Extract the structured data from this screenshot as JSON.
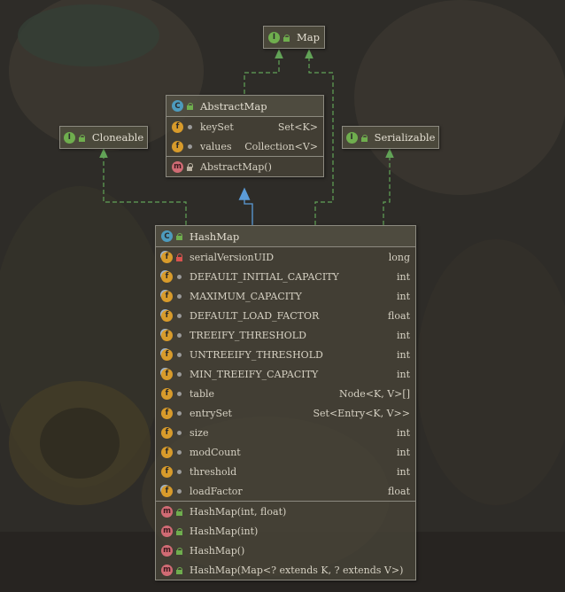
{
  "nodes": {
    "map": {
      "kind": "I",
      "name": "Map"
    },
    "cloneable": {
      "kind": "I",
      "name": "Cloneable"
    },
    "serializable": {
      "kind": "I",
      "name": "Serializable"
    },
    "abstract_map": {
      "kind": "C",
      "name": "AbstractMap",
      "fields": [
        {
          "badge": "f",
          "visibility": "package",
          "name": "keySet",
          "type": "Set<K>"
        },
        {
          "badge": "f",
          "visibility": "package",
          "name": "values",
          "type": "Collection<V>"
        }
      ],
      "methods": [
        {
          "badge": "m",
          "visibility": "protected",
          "name": "AbstractMap()"
        }
      ]
    },
    "hash_map": {
      "kind": "C",
      "name": "HashMap",
      "fields": [
        {
          "badge": "fs",
          "visibility": "private",
          "name": "serialVersionUID",
          "type": "long"
        },
        {
          "badge": "fs",
          "visibility": "package",
          "name": "DEFAULT_INITIAL_CAPACITY",
          "type": "int"
        },
        {
          "badge": "fs",
          "visibility": "package",
          "name": "MAXIMUM_CAPACITY",
          "type": "int"
        },
        {
          "badge": "fs",
          "visibility": "package",
          "name": "DEFAULT_LOAD_FACTOR",
          "type": "float"
        },
        {
          "badge": "fs",
          "visibility": "package",
          "name": "TREEIFY_THRESHOLD",
          "type": "int"
        },
        {
          "badge": "fs",
          "visibility": "package",
          "name": "UNTREEIFY_THRESHOLD",
          "type": "int"
        },
        {
          "badge": "fs",
          "visibility": "package",
          "name": "MIN_TREEIFY_CAPACITY",
          "type": "int"
        },
        {
          "badge": "f",
          "visibility": "package",
          "name": "table",
          "type": "Node<K, V>[]"
        },
        {
          "badge": "f",
          "visibility": "package",
          "name": "entrySet",
          "type": "Set<Entry<K, V>>"
        },
        {
          "badge": "f",
          "visibility": "package",
          "name": "size",
          "type": "int"
        },
        {
          "badge": "f",
          "visibility": "package",
          "name": "modCount",
          "type": "int"
        },
        {
          "badge": "f",
          "visibility": "package",
          "name": "threshold",
          "type": "int"
        },
        {
          "badge": "fs",
          "visibility": "package",
          "name": "loadFactor",
          "type": "float"
        }
      ],
      "methods": [
        {
          "badge": "m",
          "visibility": "public",
          "name": "HashMap(int, float)"
        },
        {
          "badge": "m",
          "visibility": "public",
          "name": "HashMap(int)"
        },
        {
          "badge": "m",
          "visibility": "public",
          "name": "HashMap()"
        },
        {
          "badge": "m",
          "visibility": "public",
          "name": "HashMap(Map<? extends K, ? extends V>)"
        }
      ]
    }
  },
  "edges": [
    {
      "from": "abstract_map",
      "to": "map",
      "relation": "implements"
    },
    {
      "from": "hash_map",
      "to": "abstract_map",
      "relation": "extends"
    },
    {
      "from": "hash_map",
      "to": "map",
      "relation": "implements"
    },
    {
      "from": "hash_map",
      "to": "cloneable",
      "relation": "implements"
    },
    {
      "from": "hash_map",
      "to": "serializable",
      "relation": "implements"
    }
  ],
  "colors": {
    "implements_edge": "#62a357",
    "extends_edge": "#5b9bd8"
  }
}
